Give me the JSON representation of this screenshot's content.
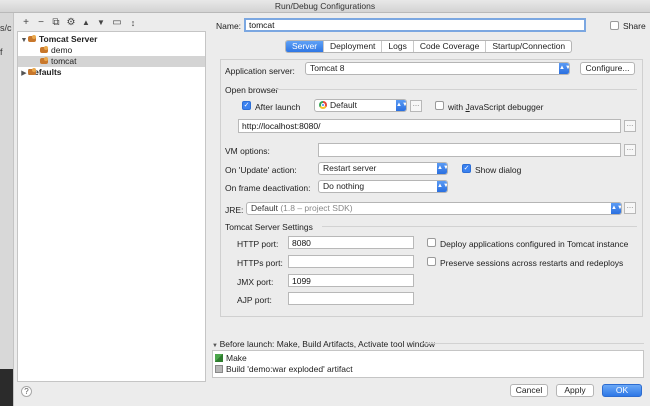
{
  "window": {
    "title": "Run/Debug Configurations"
  },
  "left_strip": {
    "fragment_top": "s/c",
    "fragment_2": "f"
  },
  "toolbar": {
    "icons": [
      "plus-icon",
      "minus-icon",
      "copy-icon",
      "wrench-icon",
      "arrow-up-icon",
      "arrow-down-icon",
      "folder-icon",
      "sort-icon"
    ]
  },
  "tree": {
    "items": [
      {
        "label": "Tomcat Server",
        "expanded": true,
        "level": 0
      },
      {
        "label": "demo",
        "level": 1
      },
      {
        "label": "tomcat",
        "level": 1,
        "selected": true
      },
      {
        "label": "Defaults",
        "expanded": false,
        "level": 0
      }
    ]
  },
  "name_row": {
    "label": "Name:",
    "value": "tomcat",
    "share_label": "Share",
    "share_checked": false
  },
  "tabs": [
    {
      "label": "Server",
      "active": true
    },
    {
      "label": "Deployment"
    },
    {
      "label": "Logs"
    },
    {
      "label": "Code Coverage"
    },
    {
      "label": "Startup/Connection"
    }
  ],
  "server": {
    "app_server_label": "Application server:",
    "app_server_value": "Tomcat 8",
    "configure_label": "Configure...",
    "open_browser_label": "Open browser",
    "after_launch_label": "After launch",
    "after_launch_checked": true,
    "browser_value": "Default",
    "js_debugger_label": "with JavaScript debugger",
    "js_debugger_checked": false,
    "url_value": "http://localhost:8080/",
    "vm_options_label": "VM options:",
    "vm_options_value": "",
    "on_update_label": "On 'Update' action:",
    "on_update_value": "Restart server",
    "show_dialog_label": "Show dialog",
    "show_dialog_checked": true,
    "on_frame_label": "On frame deactivation:",
    "on_frame_value": "Do nothing",
    "jre_label": "JRE:",
    "jre_value": "Default",
    "jre_hint": "(1.8 – project SDK)",
    "tomcat_settings_label": "Tomcat Server Settings",
    "http_port_label": "HTTP port:",
    "http_port_value": "8080",
    "https_port_label": "HTTPs port:",
    "https_port_value": "",
    "jmx_port_label": "JMX port:",
    "jmx_port_value": "1099",
    "ajp_port_label": "AJP port:",
    "ajp_port_value": "",
    "deploy_label": "Deploy applications configured in Tomcat instance",
    "deploy_checked": false,
    "preserve_label": "Preserve sessions across restarts and redeploys",
    "preserve_checked": false
  },
  "before_launch": {
    "header": "Before launch: Make, Build Artifacts, Activate tool window",
    "items": [
      "Make",
      "Build 'demo:war exploded' artifact"
    ]
  },
  "buttons": {
    "help": "?",
    "cancel": "Cancel",
    "apply": "Apply",
    "ok": "OK"
  },
  "colors": {
    "accent": "#2f76e4",
    "window_bg": "#ececec",
    "selection": "#d4d4d4"
  }
}
